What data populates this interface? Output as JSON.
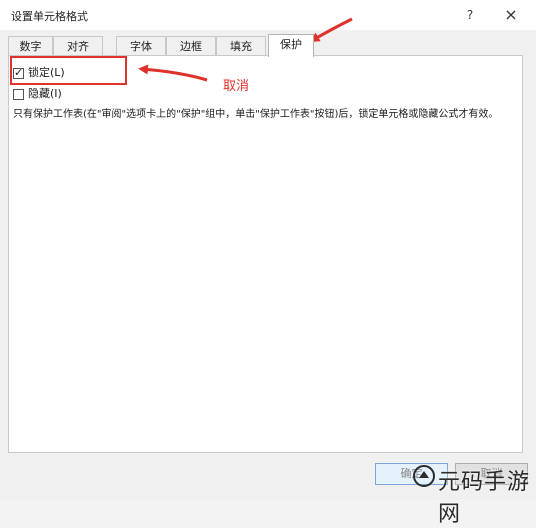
{
  "dialog": {
    "title": "设置单元格格式",
    "help_label": "?",
    "close_label": "×"
  },
  "tabs": [
    {
      "label": "数字",
      "active": false
    },
    {
      "label": "对齐",
      "active": false
    },
    {
      "label": "字体",
      "active": false
    },
    {
      "label": "边框",
      "active": false
    },
    {
      "label": "填充",
      "active": false
    },
    {
      "label": "保护",
      "active": true
    }
  ],
  "protection": {
    "locked": {
      "label": "锁定(L)",
      "checked": true
    },
    "hidden": {
      "label": "隐藏(I)",
      "checked": false
    },
    "note": "只有保护工作表(在\"审阅\"选项卡上的\"保护\"组中，单击\"保护工作表\"按钮)后，锁定单元格或隐藏公式才有效。"
  },
  "annotation": {
    "label": "取消",
    "color": "#e0312b"
  },
  "buttons": {
    "ok_label": "确定",
    "cancel_label": "取消"
  },
  "watermark": {
    "text": "元码手游网"
  }
}
